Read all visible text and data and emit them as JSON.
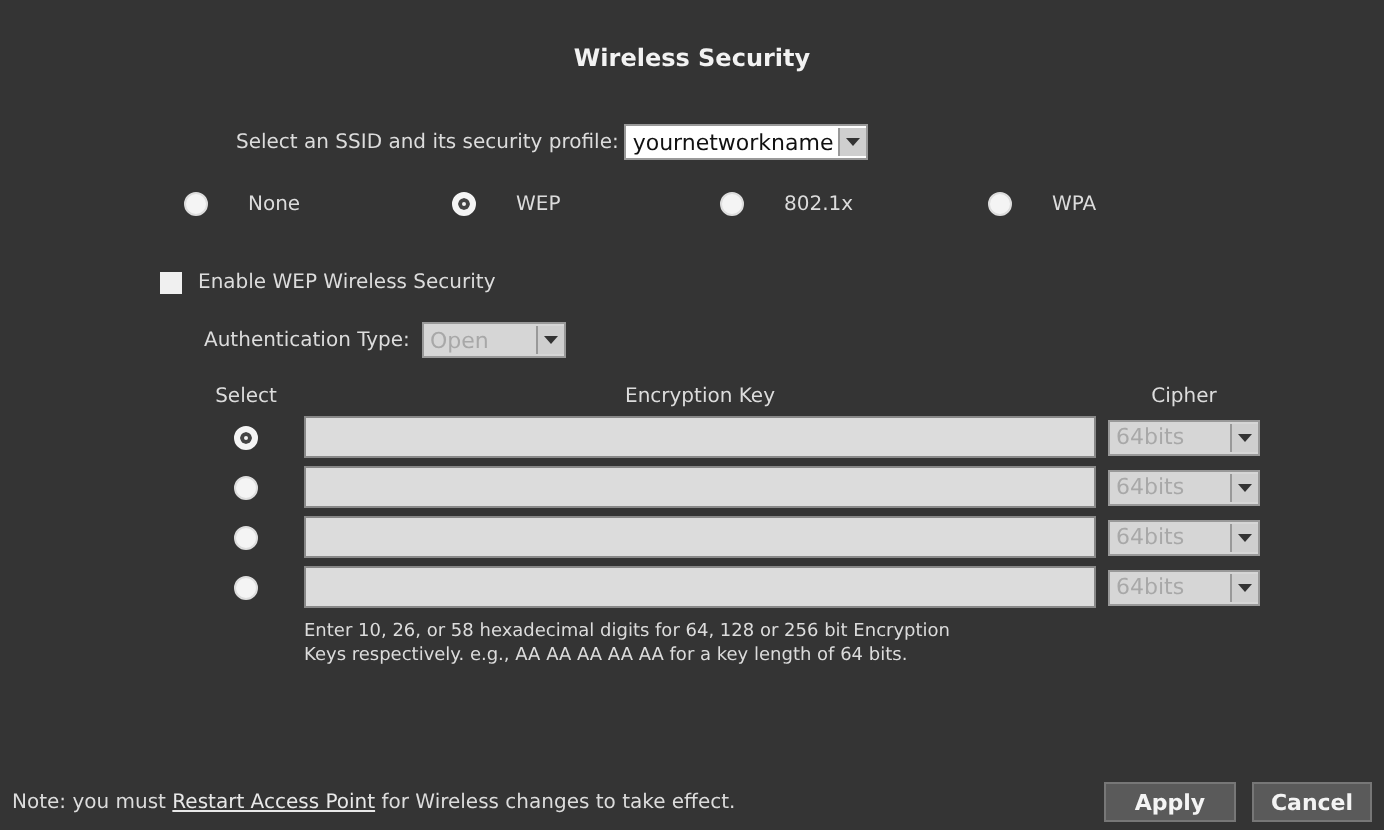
{
  "title": "Wireless Security",
  "ssid": {
    "label": "Select an SSID and its security profile:",
    "value": "yournetworkname"
  },
  "modes": [
    {
      "label": "None",
      "selected": false
    },
    {
      "label": "WEP",
      "selected": true
    },
    {
      "label": "802.1x",
      "selected": false
    },
    {
      "label": "WPA",
      "selected": false
    }
  ],
  "enable": {
    "label": "Enable WEP Wireless Security",
    "checked": false
  },
  "auth": {
    "label": "Authentication Type:",
    "value": "Open",
    "disabled": true
  },
  "keys": {
    "columns": [
      "Select",
      "Encryption Key",
      "Cipher"
    ],
    "rows": [
      {
        "selected": true,
        "cipher": "64bits",
        "disabled": true
      },
      {
        "selected": false,
        "cipher": "64bits",
        "disabled": true
      },
      {
        "selected": false,
        "cipher": "64bits",
        "disabled": true
      },
      {
        "selected": false,
        "cipher": "64bits",
        "disabled": true
      }
    ],
    "hint": "Enter 10, 26, or 58 hexadecimal digits for 64, 128 or 256 bit Encryption Keys respectively. e.g., AA AA AA AA AA for a key length of 64 bits."
  },
  "footer": {
    "before": "Note: you must",
    "link": "Restart Access Point",
    "after": "for Wireless changes to take effect."
  },
  "buttons": [
    "Apply",
    "Cancel"
  ]
}
